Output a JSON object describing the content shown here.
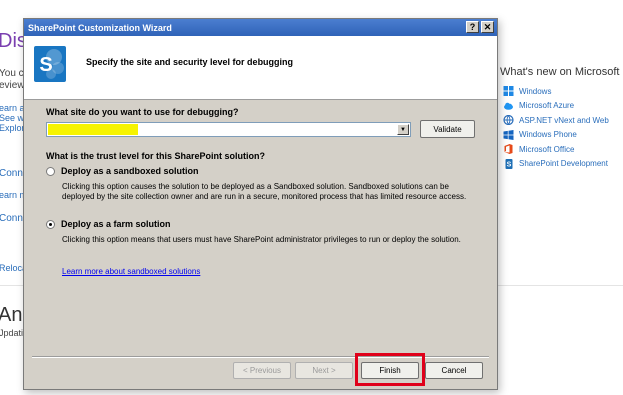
{
  "background": {
    "heading_fragment": "Disc",
    "text_frag_1": "You c",
    "text_frag_2": "eview",
    "link_frag_1": "earn a",
    "link_frag_2": "See wh",
    "link_frag_3": "Explore",
    "conn_frag_1": "Conne",
    "link_frag_4": "earn m",
    "conn_frag_2": "Conne",
    "link_frag_5": "Relocat",
    "big_frag": "Ann",
    "small_frag": "Jpdatin",
    "whats_new": {
      "title": "What's new on Microsoft",
      "items": [
        {
          "label": "Windows",
          "icon": "windows-icon",
          "color": "#1e88e5"
        },
        {
          "label": "Microsoft Azure",
          "icon": "azure-cloud-icon",
          "color": "#2196f3"
        },
        {
          "label": "ASP.NET vNext and Web",
          "icon": "aspnet-icon",
          "color": "#2a6ebb"
        },
        {
          "label": "Windows Phone",
          "icon": "windows-phone-icon",
          "color": "#1565c0"
        },
        {
          "label": "Microsoft Office",
          "icon": "office-icon",
          "color": "#e64a19"
        },
        {
          "label": "SharePoint Development",
          "icon": "sharepoint-icon",
          "color": "#1e6fb5"
        }
      ]
    }
  },
  "dialog": {
    "title": "SharePoint Customization Wizard",
    "help_glyph": "?",
    "close_glyph": "✕",
    "header_text": "Specify the site and security level for debugging",
    "site_question": "What site do you want to use for debugging?",
    "site_value": "",
    "validate_label": "Validate",
    "trust_question": "What is the trust level for this SharePoint solution?",
    "options": [
      {
        "label": "Deploy as a sandboxed solution",
        "checked": false,
        "description": "Clicking this option causes the solution to be deployed as a Sandboxed solution. Sandboxed solutions can be deployed by the site collection owner and are run in a secure, monitored process that has limited resource access."
      },
      {
        "label": "Deploy as a farm solution",
        "checked": true,
        "description": "Clicking this option means that users must have SharePoint administrator privileges to run or deploy the solution."
      }
    ],
    "learn_more": "Learn more about sandboxed solutions",
    "buttons": {
      "previous": "< Previous",
      "next": "Next >",
      "finish": "Finish",
      "cancel": "Cancel"
    },
    "accent_colors": {
      "titlebar": "#2f63b8",
      "finish_highlight": "#e0001a",
      "site_highlight": "#f6f300"
    }
  }
}
